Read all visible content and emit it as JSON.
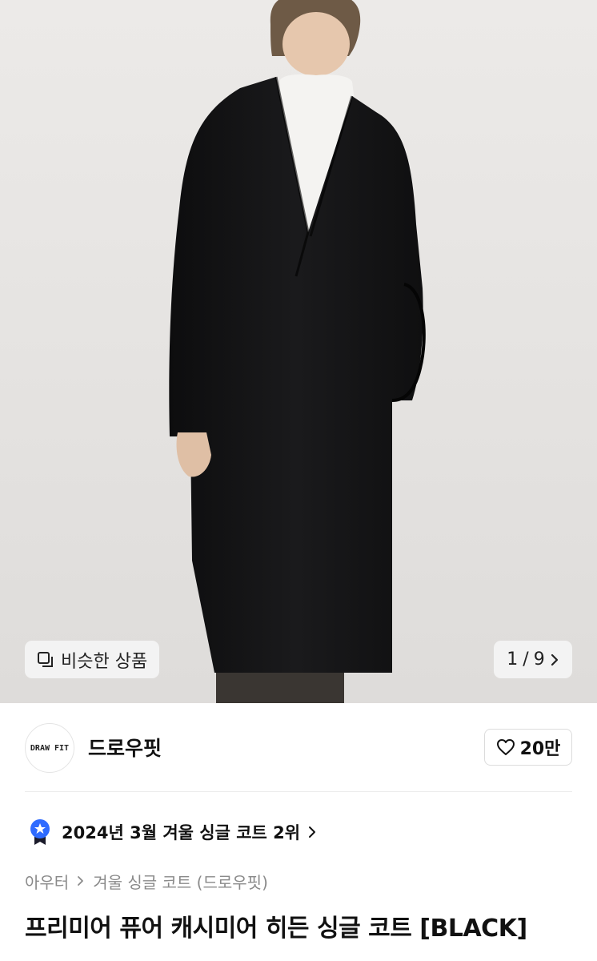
{
  "gallery": {
    "similar_button": {
      "label": "비슷한 상품",
      "icon": "copy-icon"
    },
    "counter": {
      "current": "1",
      "separator": "/",
      "total": "9",
      "icon": "chevron-right-icon"
    }
  },
  "brand": {
    "logo_text": "DRAW FIT",
    "name": "드로우핏"
  },
  "like": {
    "count": "20만",
    "icon": "heart-icon"
  },
  "ranking": {
    "text": "2024년 3월 겨울 싱글 코트 2위",
    "icon": "ranking-badge-icon",
    "badge_color": "#2f6bff"
  },
  "breadcrumb": {
    "items": [
      "아우터",
      "겨울 싱글 코트 (드로우핏)"
    ]
  },
  "product": {
    "title": "프리미어 퓨어 캐시미어 히든 싱글 코트 [BLACK]"
  }
}
